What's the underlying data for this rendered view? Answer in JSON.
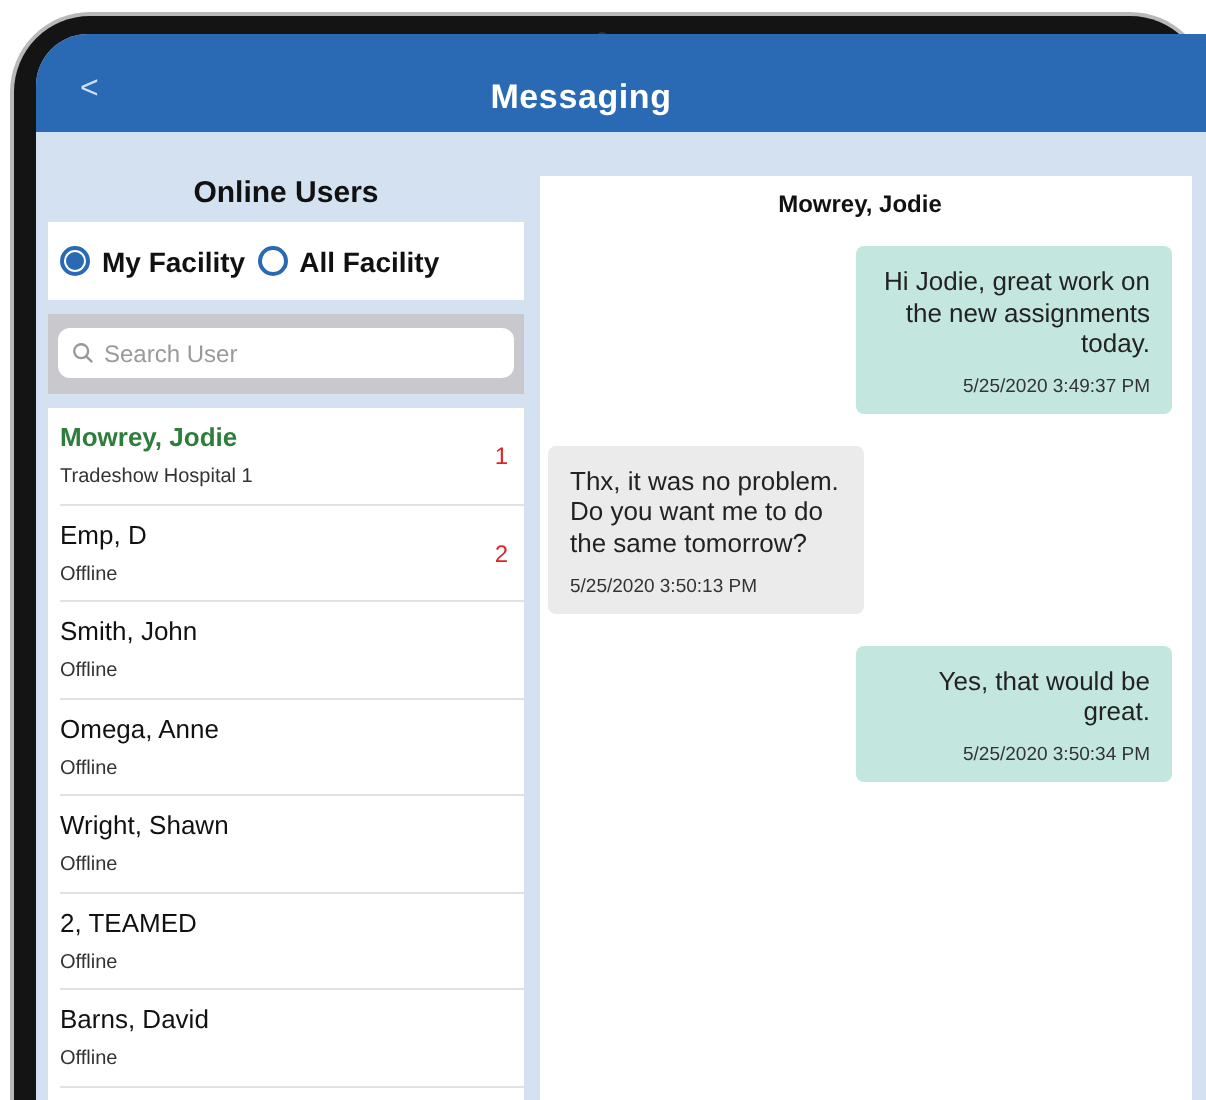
{
  "header": {
    "title": "Messaging",
    "back": "<"
  },
  "sidebar": {
    "title": "Online Users",
    "filters": [
      {
        "label": "My Facility",
        "selected": true
      },
      {
        "label": "All Facility",
        "selected": false
      }
    ],
    "search": {
      "placeholder": "Search User"
    },
    "users": [
      {
        "name": "Mowrey, Jodie",
        "status": "Tradeshow Hospital 1",
        "unread": "1",
        "selected": true
      },
      {
        "name": "Emp, D",
        "status": "Offline",
        "unread": "2",
        "selected": false
      },
      {
        "name": "Smith, John",
        "status": "Offline",
        "selected": false
      },
      {
        "name": "Omega, Anne",
        "status": "Offline",
        "selected": false
      },
      {
        "name": "Wright, Shawn",
        "status": "Offline",
        "selected": false
      },
      {
        "name": "2, TEAMED",
        "status": "Offline",
        "selected": false
      },
      {
        "name": "Barns, David",
        "status": "Offline",
        "selected": false
      }
    ]
  },
  "chat": {
    "title": "Mowrey, Jodie",
    "messages": [
      {
        "kind": "sent",
        "text": "Hi Jodie, great work on the new assignments today.",
        "time": "5/25/2020 3:49:37 PM"
      },
      {
        "kind": "received",
        "text": "Thx, it was no problem. Do you want me to do the same tomorrow?",
        "time": "5/25/2020 3:50:13 PM"
      },
      {
        "kind": "sent",
        "text": "Yes, that would be great.",
        "time": "5/25/2020 3:50:34 PM"
      }
    ]
  }
}
